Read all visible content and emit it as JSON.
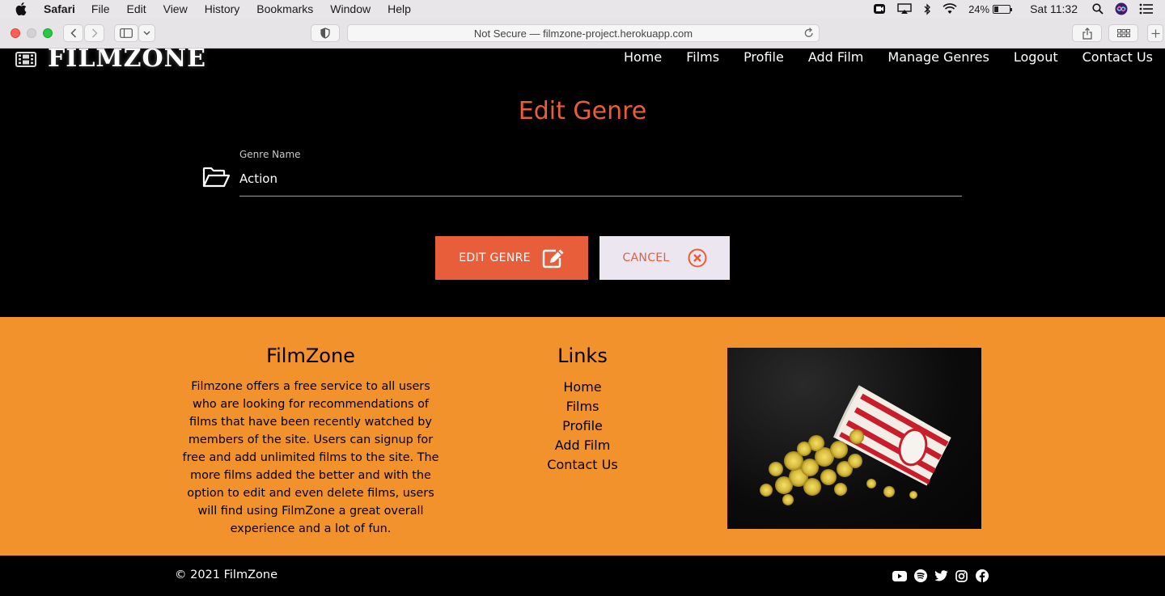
{
  "system_menubar": {
    "app_name": "Safari",
    "menus": [
      "File",
      "Edit",
      "View",
      "History",
      "Bookmarks",
      "Window",
      "Help"
    ],
    "battery": "24%",
    "clock": "Sat 11:32"
  },
  "browser": {
    "address": "Not Secure — filmzone-project.herokuapp.com"
  },
  "site": {
    "logo_text": "FILMZONE",
    "nav": [
      "Home",
      "Films",
      "Profile",
      "Add Film",
      "Manage Genres",
      "Logout",
      "Contact Us"
    ]
  },
  "form": {
    "title": "Edit Genre",
    "field_label": "Genre Name",
    "field_value": "Action",
    "submit_label": "EDIT GENRE",
    "cancel_label": "CANCEL"
  },
  "footer": {
    "about_title": "FilmZone",
    "about_text": "Filmzone offers a free service to all users who are looking for recommendations of films that have been recently watched by members of the site. Users can signup for free and add unlimited films to the site. The more films added the better and with the option to edit and even delete films, users will find using FilmZone a great overall experience and a lot of fun.",
    "links_title": "Links",
    "links": [
      "Home",
      "Films",
      "Profile",
      "Add Film",
      "Contact Us"
    ],
    "image_icon": "popcorn-image",
    "copyright": "© 2021 FilmZone",
    "social_icons": [
      "youtube-icon",
      "spotify-icon",
      "twitter-icon",
      "instagram-icon",
      "facebook-icon"
    ]
  },
  "colors": {
    "accent": "#e85d3a",
    "footer_bg": "#f2922d",
    "page_bg": "#000000",
    "cancel_bg": "#ece6f1"
  }
}
